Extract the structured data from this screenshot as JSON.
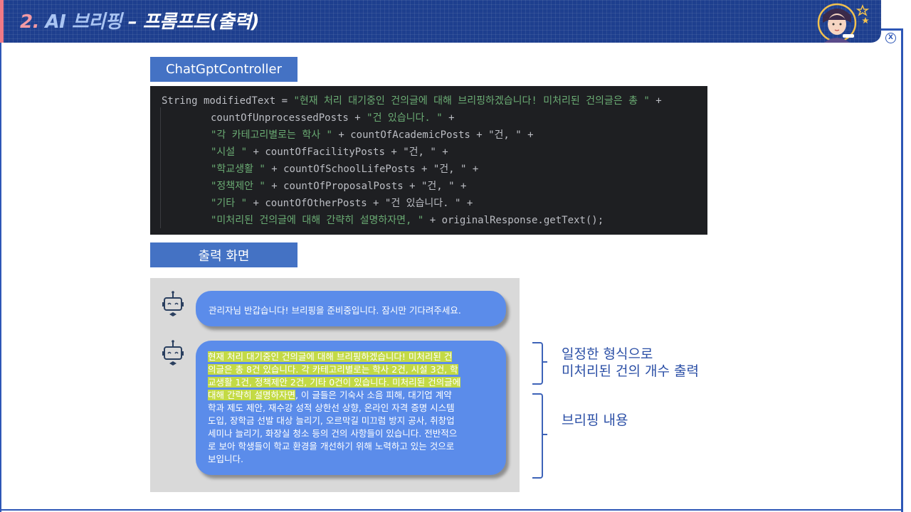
{
  "header": {
    "title_num": "2.",
    "title_ai": "AI 브리핑",
    "title_rest": "– 프롬프트(출력)",
    "close_label": "X",
    "colors": {
      "bar": "#1e3f8e",
      "accent": "#f07a86"
    }
  },
  "sections": {
    "controller_label": "ChatGptController",
    "output_label": "출력 화면"
  },
  "code": {
    "lines": [
      {
        "pre": "String modifiedText = ",
        "str": "\"현재 처리 대기중인 건의글에 대해 브리핑하겠습니다! 미처리된 건의글은 총 \"",
        "post": " +"
      },
      {
        "pre": "countOfUnprocessedPosts + ",
        "str": "\"건 있습니다. \"",
        "post": " +"
      },
      {
        "pre": "",
        "str": "\"각 카테고리별로는 학사 \"",
        "post": " + countOfAcademicPosts + \"건, \" +"
      },
      {
        "pre": "",
        "str": "\"시설 \"",
        "post": " + countOfFacilityPosts + \"건, \" +"
      },
      {
        "pre": "",
        "str": "\"학교생활 \"",
        "post": " + countOfSchoolLifePosts + \"건, \" +"
      },
      {
        "pre": "",
        "str": "\"정책제안 \"",
        "post": " + countOfProposalPosts + \"건, \" +"
      },
      {
        "pre": "",
        "str": "\"기타 \"",
        "post": " + countOfOtherPosts + \"건 있습니다. \" +"
      },
      {
        "pre": "",
        "str": "\"미처리된 건의글에 대해 간략히 설명하자면, \"",
        "post": " + originalResponse.getText();"
      }
    ]
  },
  "chat": {
    "greeting": "관리자님 반갑습니다! 브리핑을 준비중입니다. 잠시만 기다려주세요.",
    "briefing_lines": [
      {
        "hl": "현재 처리 대기중인 건의글에 대해 브리핑하겠습니다! 미처리된 건",
        "rest": ""
      },
      {
        "hl": "의글은 총 8건 있습니다. 각 카테고리별로는 학사 2건, 시설 3건, 학",
        "rest": ""
      },
      {
        "hl": "교생활 1건, 정책제안 2건, 기타 0건이 있습니다. 미처리된 건의글에",
        "rest": ""
      },
      {
        "hl": "대해 간략히 설명하자면",
        "rest": ", 이 글들은 기숙사 소음 피해, 대기업 계약"
      },
      {
        "hl": "",
        "rest": "학과 제도 제안, 재수강 성적 상한선 상향, 온라인 자격 증명 시스템"
      },
      {
        "hl": "",
        "rest": "도입, 장학금 선발 대상 늘리기, 오르막길 미끄럼 방지 공사, 취창업"
      },
      {
        "hl": "",
        "rest": "세미나 늘리기, 화장실 청소 등의 건의 사항들이 있습니다. 전반적으"
      },
      {
        "hl": "",
        "rest": "로 보아 학생들이 학교 환경을 개선하기 위해 노력하고 있는 것으로"
      },
      {
        "hl": "",
        "rest": "보입니다."
      }
    ],
    "colors": {
      "bubble": "#5b8cea",
      "highlight": "#d6e828",
      "panel": "#d9d9d9"
    }
  },
  "annotations": {
    "format_line1": "일정한 형식으로",
    "format_line2": "미처리된 건의 개수 출력",
    "content": "브리핑 내용"
  }
}
